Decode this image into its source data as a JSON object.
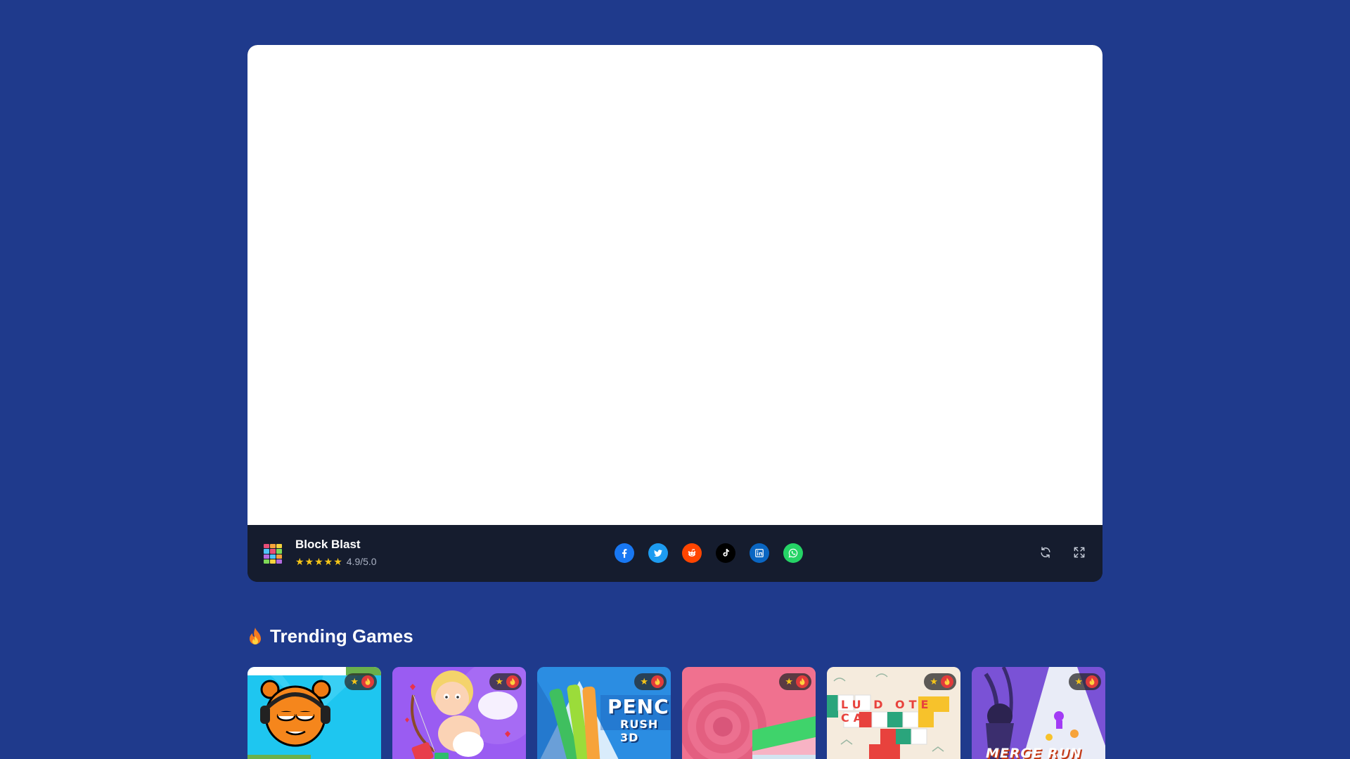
{
  "player": {
    "game_title": "Block Blast",
    "rating_stars": "★★★★★",
    "rating_text": "4.9/5.0",
    "share": [
      {
        "name": "facebook",
        "color": "#1877f2"
      },
      {
        "name": "twitter",
        "color": "#1d9bf0"
      },
      {
        "name": "reddit",
        "color": "#ff4500"
      },
      {
        "name": "tiktok",
        "color": "#000000"
      },
      {
        "name": "linkedin",
        "color": "#0a66c2"
      },
      {
        "name": "whatsapp",
        "color": "#25d366"
      }
    ],
    "controls": [
      "reload-icon",
      "fullscreen-icon"
    ]
  },
  "trending": {
    "title": "Trending Games",
    "badge_star": "★",
    "cards": [
      {
        "art": "orange-character",
        "label": ""
      },
      {
        "art": "cupid",
        "label": ""
      },
      {
        "art": "pencil-rush",
        "label_line1": "PENCI",
        "label_line2": "RUSH 3D"
      },
      {
        "art": "pink-roll",
        "label": ""
      },
      {
        "art": "ludoteca",
        "label": "LU D OTE CA"
      },
      {
        "art": "merge-run",
        "label": "MERGE RUN"
      }
    ]
  },
  "colors": {
    "background": "#1f3a8c",
    "player_bar": "#151c2e",
    "star": "#f5c518"
  }
}
